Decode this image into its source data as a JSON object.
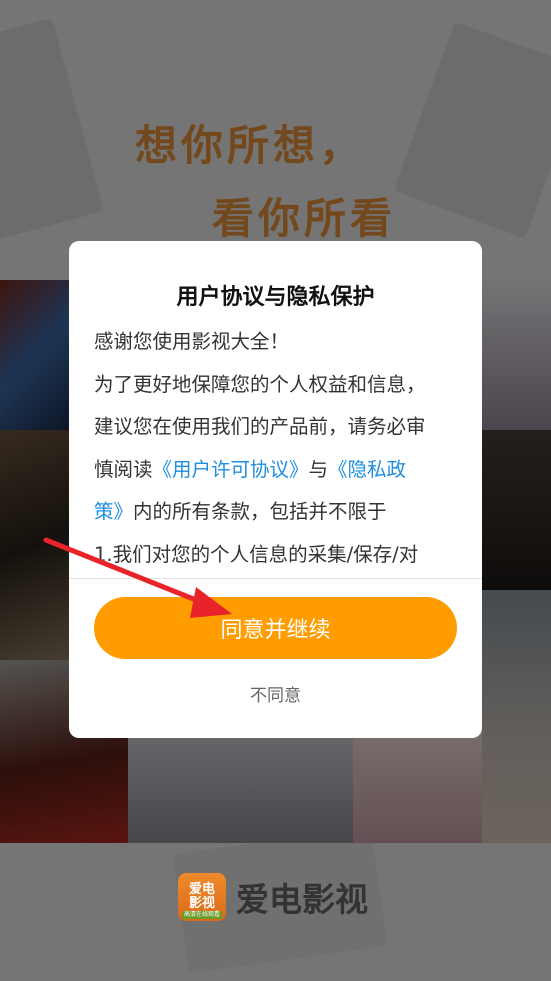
{
  "background": {
    "slogan_line1": "想你所想，",
    "slogan_line2": "看你所看"
  },
  "brand": {
    "logo_text_top": "爱电",
    "logo_text_bottom": "影视",
    "logo_tag": "高清在线观看",
    "name": "爱电影视"
  },
  "dialog": {
    "title": "用户协议与隐私保护",
    "body_line1": "感谢您使用影视大全！",
    "body_line2": "为了更好地保障您的个人权益和信息，",
    "body_line3": "建议您在使用我们的产品前，请务必审",
    "body_line4_pre": "慎阅读",
    "link_user_agreement": "《用户许可协议》",
    "body_line4_mid": "与",
    "link_privacy_part1": "《隐私政",
    "link_privacy_part2": "策》",
    "body_line5_post": "内的所有条款，包括并不限于",
    "body_line6": "1.我们对您的个人信息的采集/保存/对",
    "agree_label": "同意并继续",
    "disagree_label": "不同意"
  },
  "colors": {
    "accent": "#ff9d00",
    "link": "#1e8fe0",
    "arrow": "#e8242a"
  }
}
